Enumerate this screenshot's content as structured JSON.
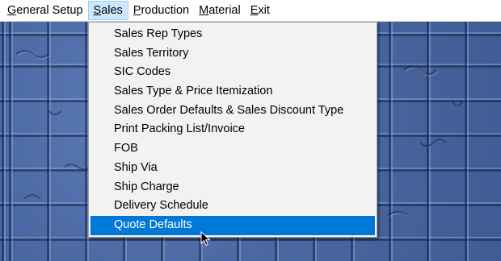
{
  "menubar": {
    "items": [
      {
        "first": "G",
        "rest": "eneral Setup"
      },
      {
        "first": "S",
        "rest": "ales"
      },
      {
        "first": "P",
        "rest": "roduction"
      },
      {
        "first": "M",
        "rest": "aterial"
      },
      {
        "first": "E",
        "rest": "xit"
      }
    ]
  },
  "sales_menu": {
    "items": [
      "Sales Rep Types",
      "Sales Territory",
      "SIC Codes",
      "Sales Type & Price Itemization",
      "Sales Order Defaults & Sales Discount Type",
      "Print Packing List/Invoice",
      "FOB",
      "Ship Via",
      "Ship Charge",
      "Delivery Schedule",
      "Quote Defaults"
    ],
    "highlighted_item": "Quote Defaults"
  },
  "colors": {
    "highlight": "#0078d7",
    "active_menu": "#cce8ff",
    "desktop": "#4b6aa5"
  }
}
